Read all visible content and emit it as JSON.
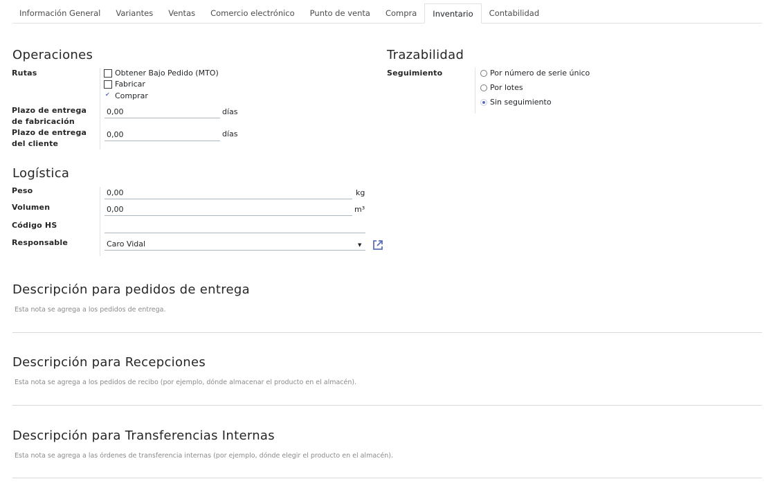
{
  "tabs": [
    {
      "label": "Información General",
      "active": false
    },
    {
      "label": "Variantes",
      "active": false
    },
    {
      "label": "Ventas",
      "active": false
    },
    {
      "label": "Comercio electrónico",
      "active": false
    },
    {
      "label": "Punto de venta",
      "active": false
    },
    {
      "label": "Compra",
      "active": false
    },
    {
      "label": "Inventario",
      "active": true
    },
    {
      "label": "Contabilidad",
      "active": false
    }
  ],
  "operations": {
    "title": "Operaciones",
    "routes_label": "Rutas",
    "routes": [
      {
        "label": "Obtener Bajo Pedido (MTO)",
        "checked": false
      },
      {
        "label": "Fabricar",
        "checked": false
      },
      {
        "label": "Comprar",
        "checked": true
      }
    ],
    "mfg_lead_label_1": "Plazo de entrega",
    "mfg_lead_label_2": "de fabricación",
    "mfg_lead_value": "0,00",
    "mfg_lead_unit": "días",
    "customer_lead_label_1": "Plazo de entrega",
    "customer_lead_label_2": "del cliente",
    "customer_lead_value": "0,00",
    "customer_lead_unit": "días"
  },
  "traceability": {
    "title": "Trazabilidad",
    "tracking_label": "Seguimiento",
    "options": [
      {
        "label": "Por número de serie único",
        "checked": false
      },
      {
        "label": "Por lotes",
        "checked": false
      },
      {
        "label": "Sin seguimiento",
        "checked": true
      }
    ]
  },
  "logistics": {
    "title": "Logística",
    "weight_label": "Peso",
    "weight_value": "0,00",
    "weight_unit": "kg",
    "volume_label": "Volumen",
    "volume_value": "0,00",
    "volume_unit": "m³",
    "hs_label": "Código HS",
    "hs_value": "",
    "responsible_label": "Responsable",
    "responsible_value": "Caro Vidal"
  },
  "descriptions": [
    {
      "title": "Descripción para pedidos de entrega",
      "note": "Esta nota se agrega a los pedidos de entrega."
    },
    {
      "title": "Descripción para Recepciones",
      "note": "Esta nota se agrega a los pedidos de recibo (por ejemplo, dónde almacenar el producto en el almacén)."
    },
    {
      "title": "Descripción para Transferencias Internas",
      "note": "Esta nota se agrega a las órdenes de transferencia internas (por ejemplo, dónde elegir el producto en el almacén)."
    }
  ],
  "colors": {
    "accent": "#5a6ebf",
    "border": "#dee2e6"
  },
  "icons": {
    "external_link": "external-link-icon",
    "dropdown": "caret-down-icon"
  }
}
